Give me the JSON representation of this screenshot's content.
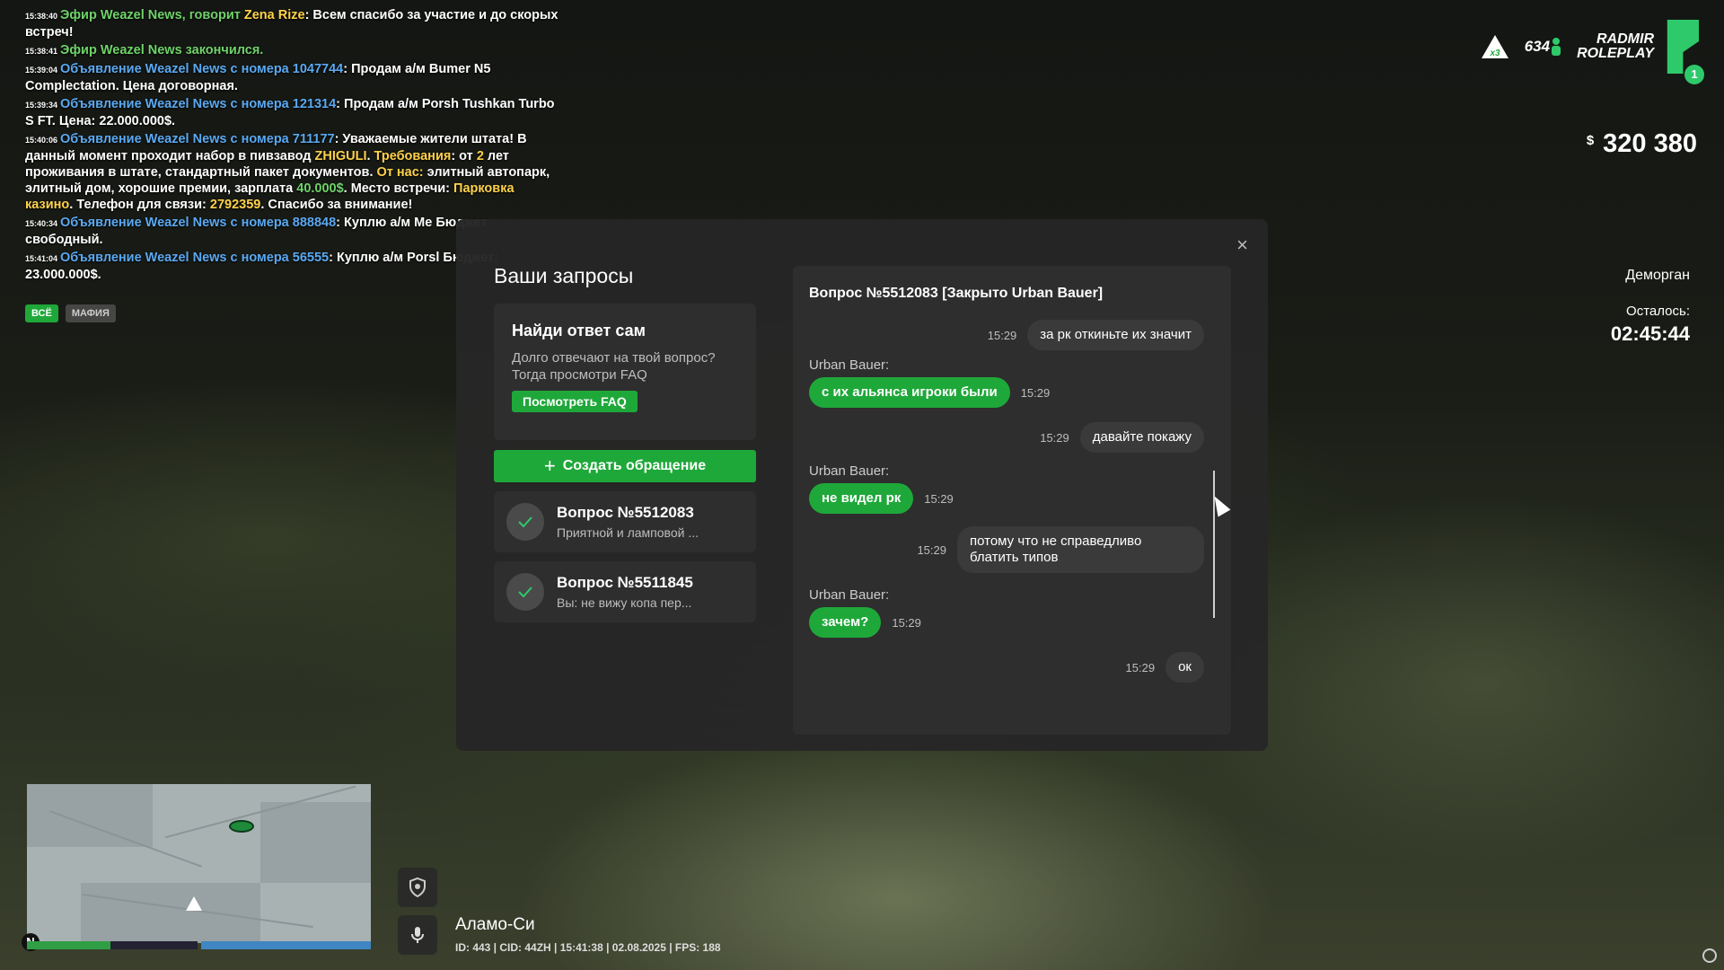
{
  "chat": {
    "lines": [
      {
        "time": "15:38:40",
        "parts": [
          {
            "t": "Эфир Weazel News, говорит ",
            "c": "c-green"
          },
          {
            "t": "Zena Rize",
            "c": "c-yellow"
          },
          {
            "t": ": Всем спасибо за участие и до скорых встреч!",
            "c": "c-white"
          }
        ]
      },
      {
        "time": "15:38:41",
        "parts": [
          {
            "t": "Эфир Weazel News закончился.",
            "c": "c-green"
          }
        ]
      },
      {
        "time": "15:39:04",
        "parts": [
          {
            "t": "Объявление Weazel News",
            "c": "c-blue"
          },
          {
            "t": " с номера ",
            "c": "c-blue"
          },
          {
            "t": "1047744",
            "c": "c-blue"
          },
          {
            "t": ": Продам а/м Bumer N5 Complectation. Цена договорная.",
            "c": "c-white"
          }
        ]
      },
      {
        "time": "15:39:34",
        "parts": [
          {
            "t": "Объявление Weazel News",
            "c": "c-blue"
          },
          {
            "t": " с номера ",
            "c": "c-blue"
          },
          {
            "t": "121314",
            "c": "c-blue"
          },
          {
            "t": ": Продам а/м Porsh Tushkan Turbo S FT. Цена: 22.000.000$.",
            "c": "c-white"
          }
        ]
      },
      {
        "time": "15:40:06",
        "parts": [
          {
            "t": "Объявление Weazel News",
            "c": "c-blue"
          },
          {
            "t": " с номера ",
            "c": "c-blue"
          },
          {
            "t": "711177",
            "c": "c-blue"
          },
          {
            "t": ": Уважаемые жители штата! В данный момент проходит набор в пивзавод ",
            "c": "c-white"
          },
          {
            "t": "ZHIGULI",
            "c": "c-yellow"
          },
          {
            "t": ". ",
            "c": "c-white"
          },
          {
            "t": "Требования",
            "c": "c-yellow"
          },
          {
            "t": ": от ",
            "c": "c-white"
          },
          {
            "t": "2",
            "c": "c-yellow"
          },
          {
            "t": " лет проживания в штате, стандартный пакет документов. ",
            "c": "c-white"
          },
          {
            "t": "От нас:",
            "c": "c-yellow"
          },
          {
            "t": " элитный автопарк, элитный дом, хорошие премии, зарплата ",
            "c": "c-white"
          },
          {
            "t": "40.000$",
            "c": "c-green"
          },
          {
            "t": ". Место встречи: ",
            "c": "c-white"
          },
          {
            "t": "Парковка казино",
            "c": "c-yellow"
          },
          {
            "t": ". Телефон для связи: ",
            "c": "c-white"
          },
          {
            "t": "2792359",
            "c": "c-yellow"
          },
          {
            "t": ". Спасибо за внимание!",
            "c": "c-white"
          }
        ]
      },
      {
        "time": "15:40:34",
        "parts": [
          {
            "t": "Объявление Weazel News",
            "c": "c-blue"
          },
          {
            "t": " с номера ",
            "c": "c-blue"
          },
          {
            "t": "888848",
            "c": "c-blue"
          },
          {
            "t": ": Куплю а/м Me",
            "c": "c-white"
          },
          {
            "t": " Бюджет свободный.",
            "c": "c-white"
          }
        ]
      },
      {
        "time": "15:41:04",
        "parts": [
          {
            "t": "Объявление Weazel News",
            "c": "c-blue"
          },
          {
            "t": " с номера ",
            "c": "c-blue"
          },
          {
            "t": "56555",
            "c": "c-blue"
          },
          {
            "t": ": Куплю а/м Porsl",
            "c": "c-white"
          },
          {
            "t": " Бюджет: 23.000.000$.",
            "c": "c-white"
          }
        ]
      }
    ],
    "tabs": [
      "ВСЁ",
      "МАФИЯ"
    ]
  },
  "hud": {
    "badge_x": "x3",
    "badge_num": "634",
    "logo_line1": "RADMIR",
    "logo_line2": "ROLEPLAY",
    "logo_num": "1",
    "money_symbol": "$",
    "money": "320 380",
    "jail_place": "Деморган",
    "jail_left_label": "Осталось:",
    "jail_timer": "02:45:44"
  },
  "modal": {
    "title": "Ваши запросы",
    "close": "×",
    "faq_title": "Найди ответ сам",
    "faq_text": "Долго отвечают на твой вопрос? Тогда просмотри FAQ",
    "faq_button": "Посмотреть FAQ",
    "create_plus": "+",
    "create_button": "Создать обращение",
    "requests": [
      {
        "title": "Вопрос №5512083",
        "sub": "Приятной и ламповой ..."
      },
      {
        "title": "Вопрос №5511845",
        "sub": "Вы: не вижу копа пер..."
      }
    ],
    "chat_title": "Вопрос №5512083 [Закрыто Urban Bauer]",
    "messages": [
      {
        "side": "mine",
        "time": "15:29",
        "text": "за рк откиньте их значит"
      },
      {
        "side": "theirs",
        "sender": "Urban Bauer:",
        "time": "15:29",
        "text": "с их альянса игроки были"
      },
      {
        "side": "mine",
        "time": "15:29",
        "text": "давайте покажу"
      },
      {
        "side": "theirs",
        "sender": "Urban Bauer:",
        "time": "15:29",
        "text": "не видел рк"
      },
      {
        "side": "mine",
        "time": "15:29",
        "text": "потому что не справедливо блатить типов"
      },
      {
        "side": "theirs",
        "sender": "Urban Bauer:",
        "time": "15:29",
        "text": "зачем?"
      },
      {
        "side": "mine",
        "time": "15:29",
        "text": "ок"
      }
    ]
  },
  "bottom": {
    "compass": "N",
    "location": "Аламо-Си",
    "status": "ID: 443 | CID: 44ZH | 15:41:38   | 02.08.2025 | FPS: 188",
    "health_pct": 0.49,
    "armor_pct": 1.0,
    "health_color": "#2f9e45",
    "armor_color": "#3f86c2"
  }
}
